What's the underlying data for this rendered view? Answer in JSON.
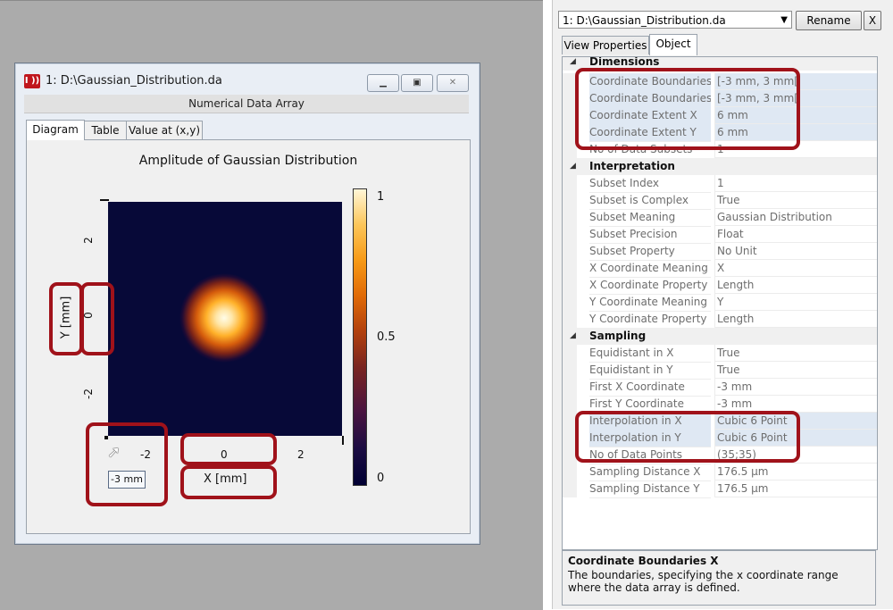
{
  "window": {
    "icon_text": "I ))",
    "title": "1: D:\\Gaussian_Distribution.da",
    "subtitle": "Numerical Data Array",
    "tabs": [
      "Diagram",
      "Table",
      "Value at (x,y)"
    ]
  },
  "chart_data": {
    "type": "heatmap",
    "title": "Amplitude of Gaussian Distribution",
    "xlabel": "X [mm]",
    "ylabel": "Y [mm]",
    "xlim": [
      -3,
      3
    ],
    "ylim": [
      -3,
      3
    ],
    "xticks": [
      "-2",
      "0",
      "2"
    ],
    "yticks": [
      "2",
      "0",
      "-2"
    ],
    "colorbar": {
      "range": [
        0,
        1
      ],
      "ticks": [
        "1",
        "0.5",
        "0"
      ],
      "colormap": "dark blue - orange - white"
    },
    "peak": {
      "x": 0,
      "y": 0,
      "value": 1
    }
  },
  "tooltip": "-3 mm",
  "panel": {
    "file_combo": "1: D:\\Gaussian_Distribution.da",
    "rename_label": "Rename",
    "close_label": "X",
    "tabs": [
      "View Properties",
      "Object"
    ],
    "rows": [
      {
        "type": "cat",
        "name": "Dimensions"
      },
      {
        "name": "Coordinate Boundaries",
        "value": "[-3 mm, 3 mm["
      },
      {
        "name": "Coordinate Boundaries",
        "value": "[-3 mm, 3 mm["
      },
      {
        "name": "Coordinate Extent X",
        "value": "6 mm"
      },
      {
        "name": "Coordinate Extent Y",
        "value": "6 mm"
      },
      {
        "name": "No of Data Subsets",
        "value": "1"
      },
      {
        "type": "cat",
        "name": "Interpretation"
      },
      {
        "name": "Subset Index",
        "value": "1"
      },
      {
        "name": "Subset is Complex",
        "value": "True"
      },
      {
        "name": "Subset Meaning",
        "value": "Gaussian Distribution"
      },
      {
        "name": "Subset Precision",
        "value": "Float"
      },
      {
        "name": "Subset Property",
        "value": "No Unit"
      },
      {
        "name": "X Coordinate Meaning",
        "value": "X"
      },
      {
        "name": "X Coordinate Property",
        "value": "Length"
      },
      {
        "name": "Y Coordinate Meaning",
        "value": "Y"
      },
      {
        "name": "Y Coordinate Property",
        "value": "Length"
      },
      {
        "type": "cat",
        "name": "Sampling"
      },
      {
        "name": "Equidistant in X",
        "value": "True"
      },
      {
        "name": "Equidistant in Y",
        "value": "True"
      },
      {
        "name": "First X Coordinate",
        "value": "-3 mm"
      },
      {
        "name": "First Y Coordinate",
        "value": "-3 mm"
      },
      {
        "name": "Interpolation in X",
        "value": "Cubic 6 Point"
      },
      {
        "name": "Interpolation in Y",
        "value": "Cubic 6 Point"
      },
      {
        "name": "No of Data Points",
        "value": "(35;35)"
      },
      {
        "name": "Sampling Distance X",
        "value": "176.5 µm"
      },
      {
        "name": "Sampling Distance Y",
        "value": "176.5 µm"
      }
    ],
    "description_title": "Coordinate Boundaries X",
    "description_text": "The boundaries, specifying the x coordinate range where the data array is defined."
  },
  "colors": {
    "highlight": "#a0121a",
    "plot_background": "#070938"
  }
}
